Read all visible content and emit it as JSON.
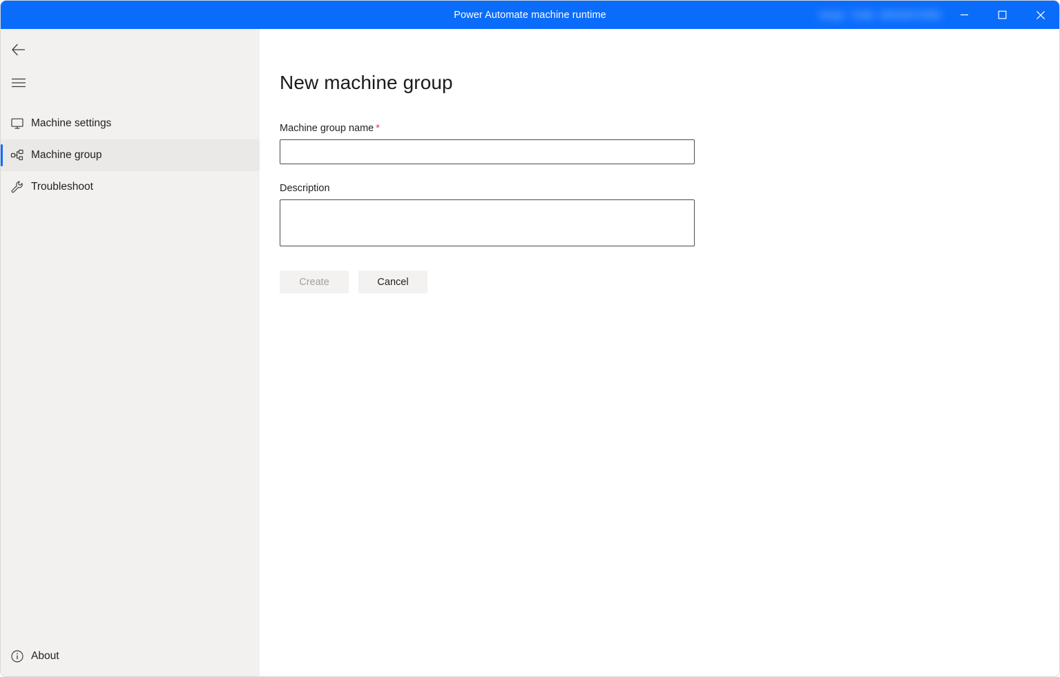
{
  "window": {
    "title": "Power Automate machine runtime",
    "accent_blue": "#0a6cfb",
    "sidebar_bg": "#f2f1f0",
    "content_bg": "#ffffff",
    "required_star_color": "#e3355f",
    "account_text_blurred": [
      "Sergio",
      "Torillo",
      "BRAINSTORM"
    ]
  },
  "titlebar": {
    "minimize_label": "Minimize",
    "maximize_label": "Maximize",
    "close_label": "Close"
  },
  "sidebar": {
    "back_label": "Back",
    "menu_label": "Menu",
    "items": [
      {
        "label": "Machine settings",
        "icon": "monitor-icon",
        "selected": false
      },
      {
        "label": "Machine group",
        "icon": "machine-group-icon",
        "selected": true
      },
      {
        "label": "Troubleshoot",
        "icon": "wrench-icon",
        "selected": false
      }
    ],
    "bottom_item": {
      "label": "About",
      "icon": "info-icon"
    }
  },
  "main": {
    "page_title": "New machine group",
    "fields": [
      {
        "label": "Machine group name",
        "required": true,
        "required_marker": "*",
        "value": "",
        "placeholder": "",
        "type": "text"
      },
      {
        "label": "Description",
        "required": false,
        "required_marker": "",
        "value": "",
        "placeholder": "",
        "type": "textarea"
      }
    ],
    "buttons": {
      "create_label": "Create",
      "create_disabled": true,
      "cancel_label": "Cancel"
    }
  }
}
